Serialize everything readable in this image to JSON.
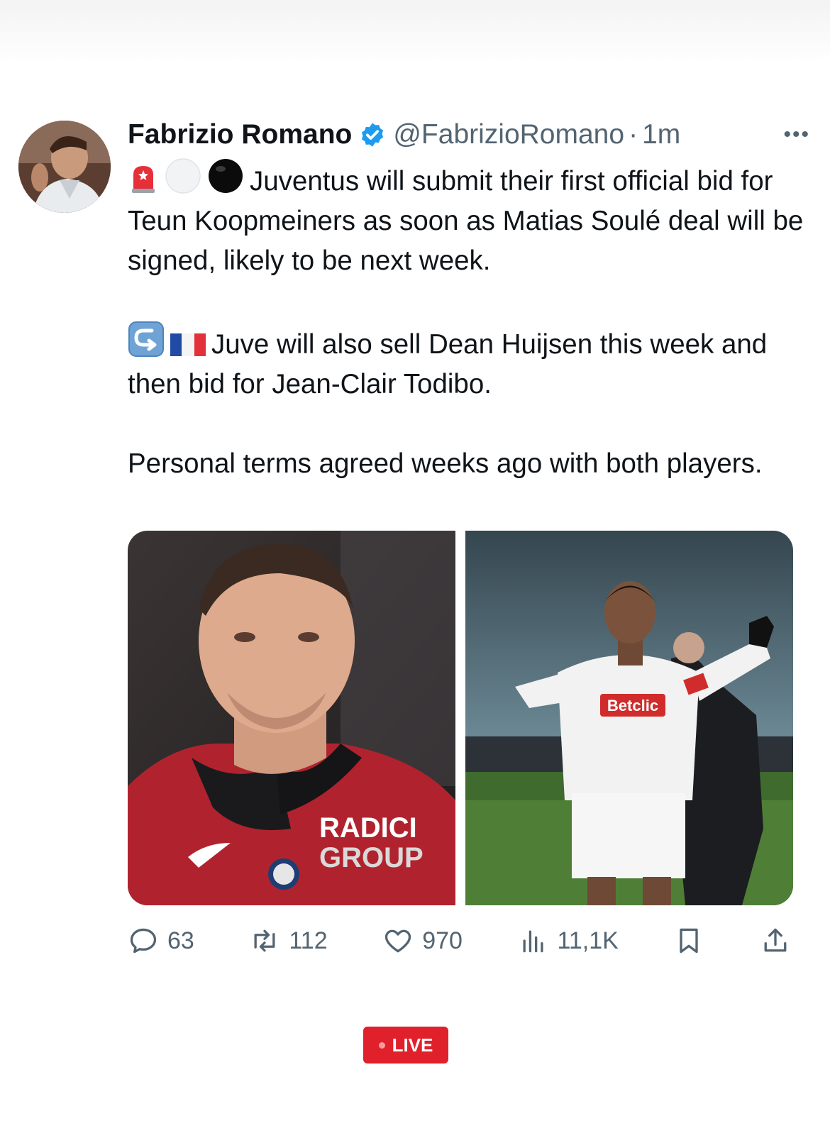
{
  "tweet": {
    "author_name": "Fabrizio Romano",
    "author_handle": "@FabrizioRomano",
    "separator": "·",
    "timestamp": "1m",
    "more_label": "•••",
    "paragraphs": [
      "Juventus will submit their first official bid for Teun Koopmeiners as soon as Matias Soulé deal will be signed, likely to be next week.",
      "Juve will also sell Dean Huijsen this week and then bid for Jean-Clair Todibo.",
      "Personal terms agreed weeks ago with both players."
    ],
    "icons": {
      "para1": [
        "rotating-light-icon",
        "white-circle-icon",
        "black-circle-icon"
      ],
      "para2": [
        "right-arrow-curving-left-icon",
        "france-flag-icon"
      ]
    },
    "media": {
      "photo_left_text": [
        "RADICI",
        "GROUP"
      ],
      "photo_right_text": "Betclic"
    }
  },
  "actions": {
    "replies": "63",
    "reposts": "112",
    "likes": "970",
    "views": "11,1K"
  },
  "live_label": "LIVE",
  "colors": {
    "text": "#0f1419",
    "secondary": "#536471",
    "verified": "#1d9bf0",
    "live": "#e0202a"
  }
}
